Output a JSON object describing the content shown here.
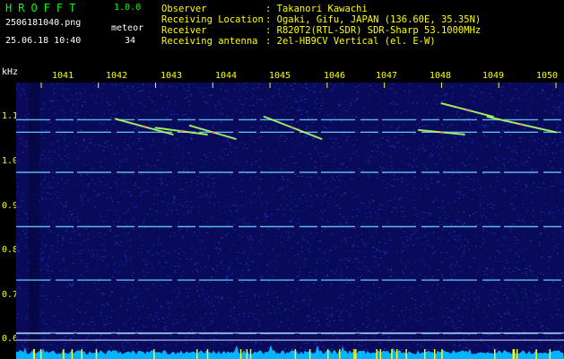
{
  "header": {
    "logo": "HROFFT",
    "version": "1.0.0",
    "filename": "2506181040.png",
    "datetime": "25.06.18 10:40",
    "meteor_label": "meteor",
    "meteor_count": "34",
    "info": [
      {
        "label": "Observer",
        "value": ": Takanori Kawachi"
      },
      {
        "label": "Receiving Location",
        "value": ": Ogaki, Gifu, JAPAN (136.60E, 35.35N)"
      },
      {
        "label": "Receiver",
        "value": ": R820T2(RTL-SDR) SDR-Sharp 53.1000MHz"
      },
      {
        "label": "Receiving antenna",
        "value": ": 2el-HB9CV Vertical (el. E-W)"
      }
    ]
  },
  "chart_data": {
    "type": "heatmap",
    "ylabel": "kHz",
    "x_ticks": [
      "1041",
      "1042",
      "1043",
      "1044",
      "1045",
      "1046",
      "1047",
      "1048",
      "1049",
      "1050"
    ],
    "y_ticks": [
      "1.1",
      "1.0",
      "0.9",
      "0.8",
      "0.7",
      "0.6"
    ],
    "xlim": [
      1040.6,
      1050.2
    ],
    "ylim": [
      0.58,
      1.17
    ],
    "carriers_khz": [
      1.093,
      1.065,
      0.975,
      0.853,
      0.733,
      0.613
    ],
    "meteor_echoes": [
      {
        "x": [
          1042.3,
          1043.3
        ],
        "y": [
          1.095,
          1.06
        ]
      },
      {
        "x": [
          1043.0,
          1043.9
        ],
        "y": [
          1.075,
          1.06
        ]
      },
      {
        "x": [
          1043.6,
          1044.4
        ],
        "y": [
          1.08,
          1.05
        ]
      },
      {
        "x": [
          1044.9,
          1045.9
        ],
        "y": [
          1.1,
          1.05
        ]
      },
      {
        "x": [
          1047.6,
          1048.4
        ],
        "y": [
          1.07,
          1.06
        ]
      },
      {
        "x": [
          1048.0,
          1048.9
        ],
        "y": [
          1.13,
          1.1
        ]
      },
      {
        "x": [
          1048.8,
          1050.0
        ],
        "y": [
          1.1,
          1.065
        ]
      }
    ],
    "colors": {
      "background": "#0a0a5a",
      "noise": "#2a4aff",
      "carrier": "#6ad8ff",
      "echo": "#b0ff60",
      "strong": "#ff60a0"
    }
  }
}
